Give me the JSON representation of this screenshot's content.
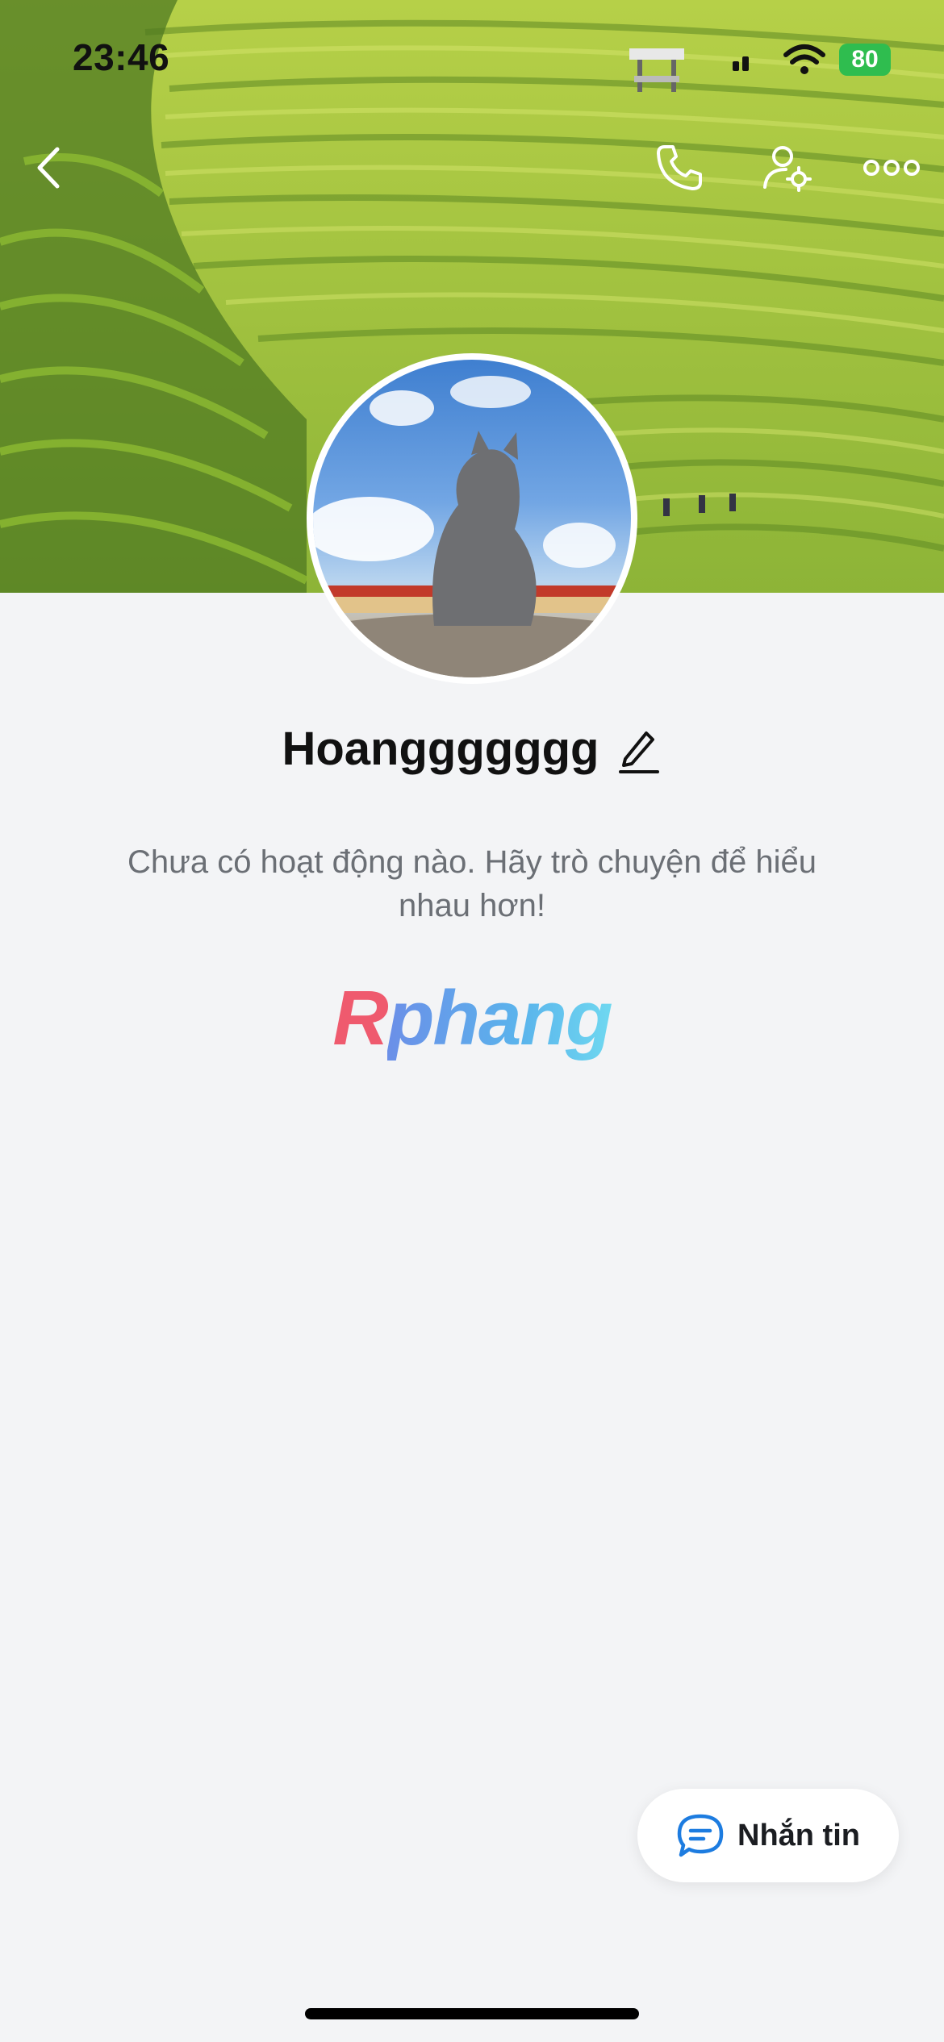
{
  "status_bar": {
    "time": "23:46",
    "battery": "80",
    "icons": [
      "signal-icon",
      "wifi-icon",
      "battery-icon"
    ]
  },
  "nav": {
    "back_icon": "chevron-left-icon",
    "call_icon": "phone-icon",
    "settings_icon": "user-settings-icon",
    "more_icon": "more-dots-icon"
  },
  "profile": {
    "name": "Hoanggggggg",
    "edit_icon": "pencil-icon",
    "empty_message": "Chưa có hoạt động nào. Hãy trò chuyện để hiểu nhau hơn!"
  },
  "logo": {
    "part_a": "R",
    "part_b": "phang"
  },
  "chat_button": {
    "label": "Nhắn tin",
    "icon": "chat-bubble-icon"
  },
  "colors": {
    "background": "#f3f4f6",
    "accent_blue": "#1d7ce0",
    "battery_green": "#2fbd4f"
  }
}
